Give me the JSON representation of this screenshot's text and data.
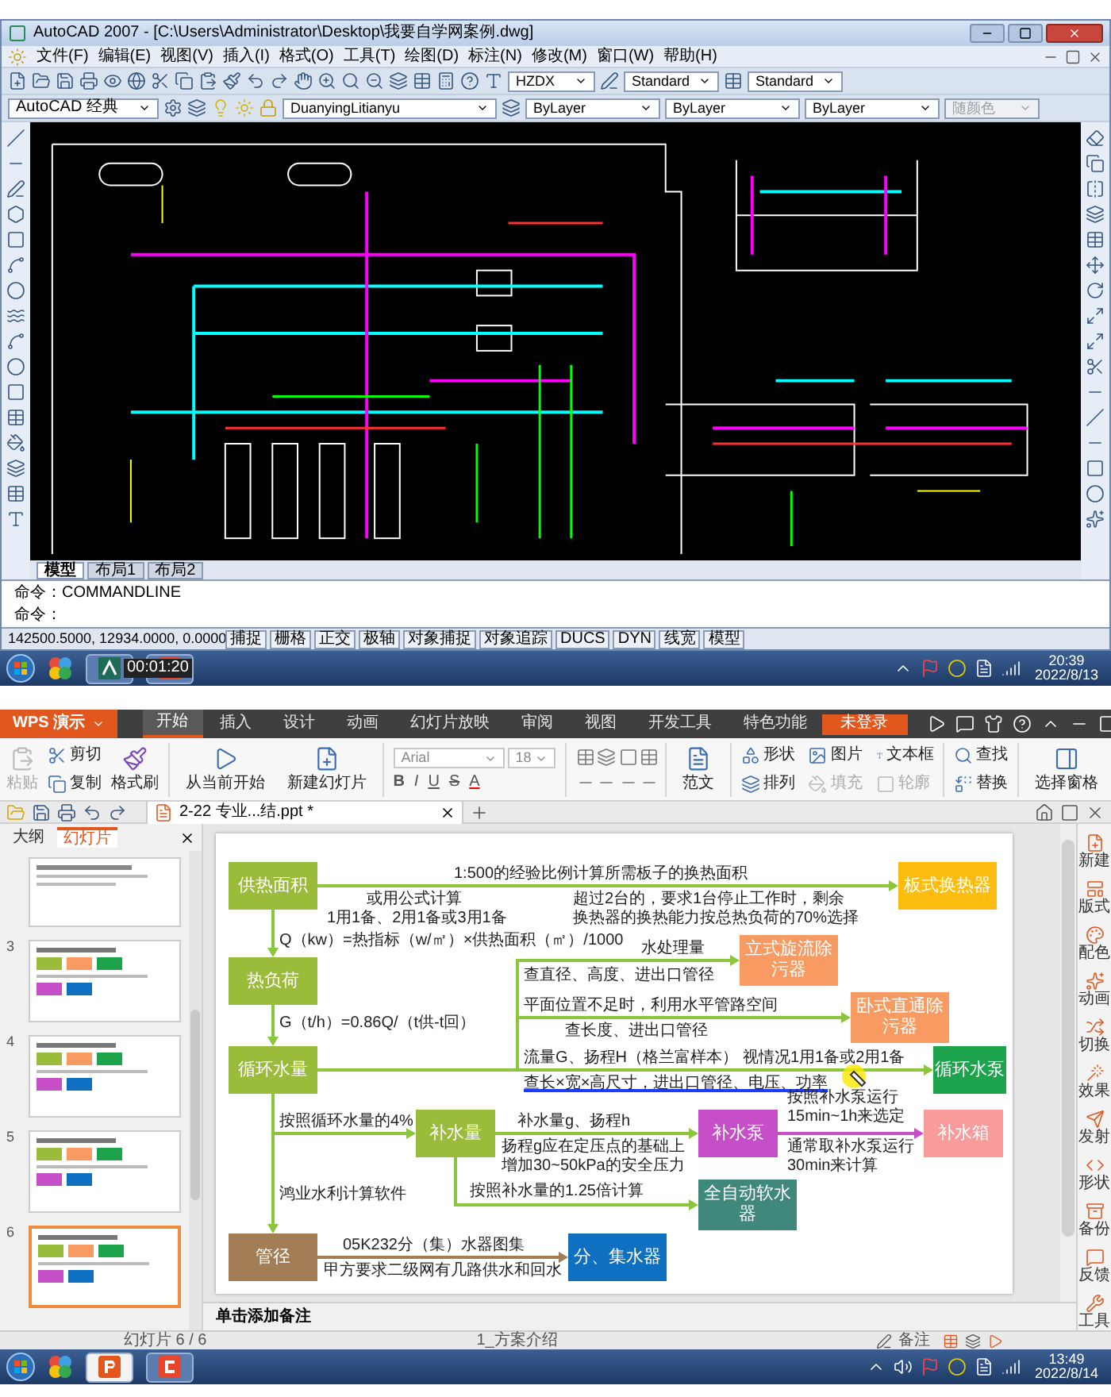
{
  "cad": {
    "title": "AutoCAD 2007 - [C:\\Users\\Administrator\\Desktop\\我要自学网案例.dwg]",
    "menu": [
      "文件(F)",
      "编辑(E)",
      "视图(V)",
      "插入(I)",
      "格式(O)",
      "工具(T)",
      "绘图(D)",
      "标注(N)",
      "修改(M)",
      "窗口(W)",
      "帮助(H)"
    ],
    "style_dropdowns": [
      "HZDX",
      "Standard",
      "Standard"
    ],
    "workspace": "AutoCAD 经典",
    "layer": "DuanyingLitianyu",
    "property_dropdowns": [
      {
        "value": "ByLayer",
        "disabled": false
      },
      {
        "value": "ByLayer",
        "disabled": false
      },
      {
        "value": "ByLayer",
        "disabled": false
      },
      {
        "value": "随颜色",
        "disabled": true
      }
    ],
    "layout_tabs": [
      {
        "label": "模型",
        "selected": true
      },
      {
        "label": "布局1",
        "selected": false
      },
      {
        "label": "布局2",
        "selected": false
      }
    ],
    "command_lines": [
      "命令：COMMANDLINE",
      "命令："
    ],
    "coordinates": "142500.5000, 12934.0000, 0.0000",
    "status_toggles": [
      "捕捉",
      "栅格",
      "正交",
      "极轴",
      "对象捕捉",
      "对象追踪",
      "DUCS",
      "DYN",
      "线宽",
      "模型"
    ]
  },
  "taskbar_top": {
    "timer": "00:01:20",
    "time": "20:39",
    "date": "2022/8/13"
  },
  "wps": {
    "app_name": "WPS 演示",
    "tabs": [
      {
        "label": "开始",
        "selected": true
      },
      {
        "label": "插入",
        "selected": false
      },
      {
        "label": "设计",
        "selected": false
      },
      {
        "label": "动画",
        "selected": false
      },
      {
        "label": "幻灯片放映",
        "selected": false
      },
      {
        "label": "审阅",
        "selected": false
      },
      {
        "label": "视图",
        "selected": false
      },
      {
        "label": "开发工具",
        "selected": false
      },
      {
        "label": "特色功能",
        "selected": false
      }
    ],
    "login": "未登录",
    "clipboard": [
      {
        "label": "粘贴",
        "disabled": true
      },
      {
        "label": "剪切",
        "disabled": false
      },
      {
        "label": "复制",
        "disabled": false
      },
      {
        "label": "格式刷",
        "disabled": false
      }
    ],
    "slide_buttons": [
      "从当前开始",
      "新建幻灯片"
    ],
    "font": "Arial",
    "font_size": "18",
    "format_buttons": [
      "B",
      "I",
      "U",
      "S",
      "A"
    ],
    "template": "范文",
    "insert_buttons": [
      {
        "label": "形状",
        "disabled": false
      },
      {
        "label": "图片",
        "disabled": false
      },
      {
        "label": "文本框",
        "disabled": false
      },
      {
        "label": "排列",
        "disabled": false
      },
      {
        "label": "填充",
        "disabled": true
      },
      {
        "label": "轮廓",
        "disabled": true
      }
    ],
    "edit_buttons": [
      "查找",
      "替换"
    ],
    "selection_pane": "选择窗格",
    "document_tab": "2-22 专业...结.ppt *",
    "panel_tabs": [
      {
        "label": "大纲",
        "selected": false
      },
      {
        "label": "幻灯片",
        "selected": true
      }
    ],
    "thumbnails": [
      {
        "number": "3",
        "selected": false
      },
      {
        "number": "4",
        "selected": false
      },
      {
        "number": "5",
        "selected": false
      },
      {
        "number": "6",
        "selected": true
      }
    ],
    "slide": {
      "nodes": [
        {
          "text": "供热面积",
          "color": "#9bbb3b"
        },
        {
          "text": "板式换热器",
          "color": "#fdbd10"
        },
        {
          "text": "热负荷",
          "color": "#9bbb3b"
        },
        {
          "text": "立式旋流除污器",
          "color": "#f79b63"
        },
        {
          "text": "卧式直通除污器",
          "color": "#f79b63"
        },
        {
          "text": "循环水量",
          "color": "#9bbb3b"
        },
        {
          "text": "循环水泵",
          "color": "#1da34c"
        },
        {
          "text": "补水量",
          "color": "#9bbb3b"
        },
        {
          "text": "补水泵",
          "color": "#c64fc8"
        },
        {
          "text": "补水箱",
          "color": "#f99b9b"
        },
        {
          "text": "全自动软水器",
          "color": "#40877c"
        },
        {
          "text": "管径",
          "color": "#a27d55"
        },
        {
          "text": "分、集水器",
          "color": "#0f6fc0"
        }
      ],
      "labels": [
        {
          "text": "1:500的经验比例计算所需板子的换热面积",
          "underlined": false
        },
        {
          "text": "或用公式计算",
          "underlined": false
        },
        {
          "text": "1用1备、2用1备或3用1备",
          "underlined": false
        },
        {
          "text": "超过2台的，要求1台停止工作时，剩余",
          "underlined": false
        },
        {
          "text": "换热器的换热能力按总热负荷的70%选择",
          "underlined": false
        },
        {
          "text": "Q（kw）=热指标（w/㎡）×供热面积（㎡）/1000",
          "underlined": false
        },
        {
          "text": "水处理量",
          "underlined": false
        },
        {
          "text": "查直径、高度、进出口管径",
          "underlined": false
        },
        {
          "text": "平面位置不足时，利用水平管路空间",
          "underlined": false
        },
        {
          "text": "查长度、进出口管径",
          "underlined": false
        },
        {
          "text": "G（t/h）=0.86Q/（t供-t回）",
          "underlined": false
        },
        {
          "text": "流量G、扬程H（格兰富样本）",
          "underlined": false
        },
        {
          "text": "视情况1用1备或2用1备",
          "underlined": false
        },
        {
          "text": "查长×宽×高尺寸，进出口管径、电压、功率",
          "underlined": true
        },
        {
          "text": "按照循环水量的4%",
          "underlined": false
        },
        {
          "text": "补水量g、扬程h",
          "underlined": false
        },
        {
          "text": "扬程g应在定压点的基础上",
          "underlined": false
        },
        {
          "text": "增加30~50kPa的安全压力",
          "underlined": false
        },
        {
          "text": "按照补水泵运行15min~1h来选定",
          "underlined": false
        },
        {
          "text": "通常取补水泵运行30min来计算",
          "underlined": false
        },
        {
          "text": "鸿业水利计算软件",
          "underlined": false
        },
        {
          "text": "按照补水量的1.25倍计算",
          "underlined": false
        },
        {
          "text": "05K232分（集）水器图集",
          "underlined": false
        },
        {
          "text": "甲方要求二级网有几路供水和回水",
          "underlined": false
        }
      ]
    },
    "notes_placeholder": "单击添加备注",
    "sidebar": [
      "新建",
      "版式",
      "配色",
      "动画",
      "切换",
      "效果",
      "发射",
      "形状",
      "备份",
      "反馈",
      "工具"
    ],
    "status": {
      "slide_count": "幻灯片 6 / 6",
      "theme": "1_方案介绍",
      "notes_button": "备注"
    }
  },
  "taskbar_bottom": {
    "time": "13:49",
    "date": "2022/8/14"
  }
}
